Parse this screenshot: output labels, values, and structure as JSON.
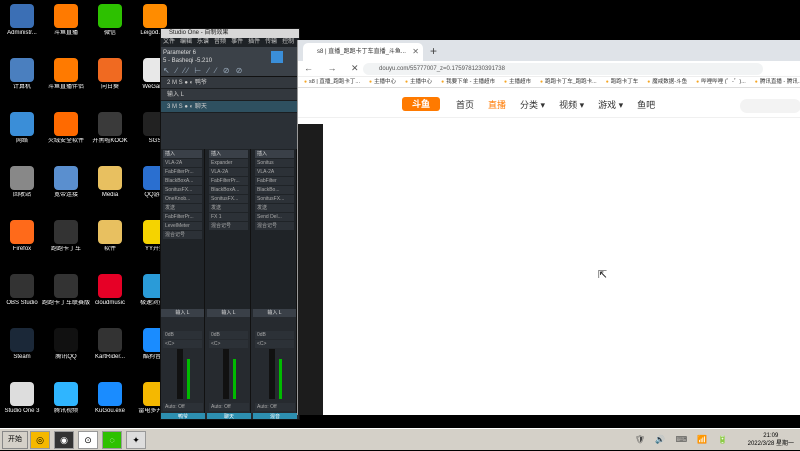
{
  "desktop_icons": [
    {
      "label": "Administr...",
      "icon": "user-icon",
      "color": "#3b6fb5"
    },
    {
      "label": "斗鱼直播",
      "icon": "douyu-icon",
      "color": "#ff7a00"
    },
    {
      "label": "微信",
      "icon": "wechat-icon",
      "color": "#2dc100"
    },
    {
      "label": "Leigod.exe",
      "icon": "leigod-icon",
      "color": "#ff8c00"
    },
    {
      "label": "计算机",
      "icon": "computer-icon",
      "color": "#4a7fbf"
    },
    {
      "label": "斗鱼直播伴侣",
      "icon": "douyu-companion-icon",
      "color": "#ff7a00"
    },
    {
      "label": "向日葵",
      "icon": "sunflower-icon",
      "color": "#f06a21"
    },
    {
      "label": "WeGame",
      "icon": "wegame-icon",
      "color": "#e8e8e8"
    },
    {
      "label": "网络",
      "icon": "network-icon",
      "color": "#3a8ed8"
    },
    {
      "label": "火绒安全软件",
      "icon": "huorong-icon",
      "color": "#ff6a00"
    },
    {
      "label": "开黑啦KOOK",
      "icon": "kook-icon",
      "color": "#3a3a3a"
    },
    {
      "label": "SGS",
      "icon": "sgs-icon",
      "color": "#222"
    },
    {
      "label": "回收站",
      "icon": "recycle-bin-icon",
      "color": "#888"
    },
    {
      "label": "宽带连接",
      "icon": "broadband-icon",
      "color": "#5a8fcf"
    },
    {
      "label": "Media",
      "icon": "folder-icon",
      "color": "#e8c060"
    },
    {
      "label": "QQ游戏",
      "icon": "qq-game-icon",
      "color": "#2a6fd0"
    },
    {
      "label": "Firefox",
      "icon": "firefox-icon",
      "color": "#ff6a1a"
    },
    {
      "label": "跑跑卡丁车",
      "icon": "kart-icon",
      "color": "#333"
    },
    {
      "label": "软件",
      "icon": "folder-icon",
      "color": "#e8c060"
    },
    {
      "label": "YY开播",
      "icon": "yy-icon",
      "color": "#f5d300"
    },
    {
      "label": "OBS Studio",
      "icon": "obs-icon",
      "color": "#333"
    },
    {
      "label": "跑跑卡丁车联赛版",
      "icon": "kart-icon",
      "color": "#333"
    },
    {
      "label": "cloudmusic",
      "icon": "netease-music-icon",
      "color": "#e60026"
    },
    {
      "label": "极速浏览器",
      "icon": "browser-icon",
      "color": "#2a9bd8"
    },
    {
      "label": "Steam",
      "icon": "steam-icon",
      "color": "#1b2838"
    },
    {
      "label": "腾讯QQ",
      "icon": "qq-icon",
      "color": "#111"
    },
    {
      "label": "KartRider...",
      "icon": "kart-icon",
      "color": "#333"
    },
    {
      "label": "酷狗音乐",
      "icon": "kugou-icon",
      "color": "#1a8cff"
    },
    {
      "label": "Studio One 3",
      "icon": "studio-one-icon",
      "color": "#ddd"
    },
    {
      "label": "腾讯视频",
      "icon": "tencent-video-icon",
      "color": "#2fb5ff"
    },
    {
      "label": "KuGou.exe",
      "icon": "kugou-icon",
      "color": "#1a8cff"
    },
    {
      "label": "雷电多开器4",
      "icon": "ldplayer-icon",
      "color": "#f5b800"
    }
  ],
  "studio": {
    "title": "Studio One - 自制效果",
    "menu": [
      "文件",
      "编辑",
      "乐谱",
      "音频",
      "事件",
      "插件",
      "传输",
      "控制"
    ],
    "param_name": "Parameter 6",
    "param_sub": "5 - Basheqi",
    "param_value": "-5.210",
    "tools": "↖ ∕ ∕∕ ⊢ ∕ ∕ ⊘ ⊘",
    "tracks": [
      {
        "num": "2",
        "label": "M S ● ◐  鸭爷"
      },
      {
        "num": "",
        "label": "输入 L"
      },
      {
        "num": "3",
        "label": "M S ● ◐  聊天"
      }
    ],
    "insert_columns": [
      {
        "header": "插入",
        "slots": [
          "VLA-2A",
          "FabFilterPr...",
          "BlackBoxA...",
          "SonitusFX...",
          "OneKnob...",
          "发送",
          "FabFilterPr...",
          "LevelMeter",
          "混合记号"
        ]
      },
      {
        "header": "插入",
        "slots": [
          "Expander",
          "VLA-2A",
          "FabFilterPr...",
          "BlackBoxA...",
          "SonitusFX...",
          "发送",
          "FX 1",
          "混合记号"
        ]
      },
      {
        "header": "插入",
        "slots": [
          "Sonitus",
          "VLA-2A",
          "FabFilter",
          "BlackBo...",
          "SonitusFX...",
          "发送",
          "Send Del...",
          "混合记号"
        ]
      }
    ],
    "strips": [
      {
        "name": "输入 L",
        "bottom": "鸭爷",
        "db": "0dB",
        "pan": "<C>",
        "mode": "Auto: Off"
      },
      {
        "name": "输入 L",
        "bottom": "聊天",
        "db": "0dB",
        "pan": "<C>",
        "mode": "Auto: Off"
      },
      {
        "name": "输入 L",
        "bottom": "混音",
        "db": "0dB",
        "pan": "<C>",
        "mode": "Auto: Off"
      }
    ]
  },
  "browser": {
    "tab_title": "s8 | 直播_跑跑卡丁车直播_斗鱼...",
    "new_tab": "+",
    "nav_buttons": "← → ✕",
    "url": "douyu.com/55777007_z=0.1759781230391738",
    "bookmarks": [
      "s8 | 直播_跑跑卡丁...",
      "主播中心",
      "主播中心",
      "我要下单 - 主播超市",
      "主播超市",
      "跑跑卡丁车_跑跑卡...",
      "跑跑卡丁车",
      "魔戒数据-斗鱼",
      "哔哩哔哩 (゜-゜)...",
      "腾讯直播 - 腾讯..."
    ],
    "logo": "斗鱼",
    "nav_items": [
      "首页",
      "直播",
      "分类 ▾",
      "视频 ▾",
      "游戏 ▾",
      "鱼吧"
    ]
  },
  "taskbar": {
    "start_label": "开始",
    "tray_icons": "🛡 🔊 ⌨ 📶 🔋",
    "time": "21:09",
    "date": "2022/3/28 星期一"
  }
}
